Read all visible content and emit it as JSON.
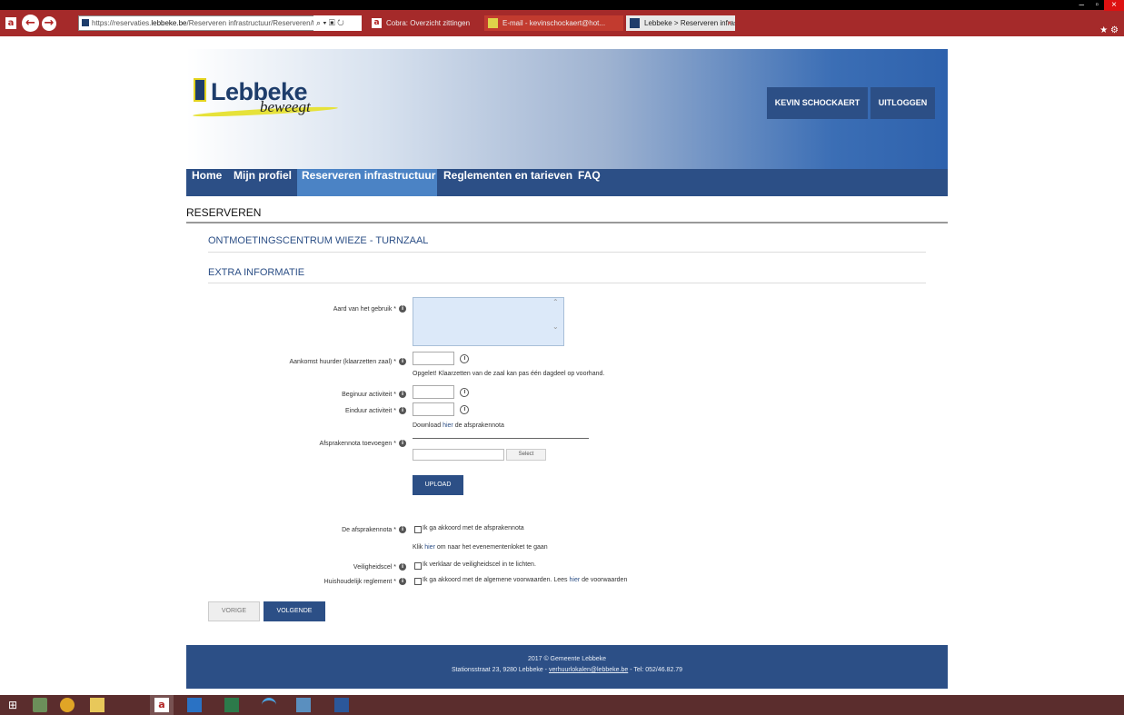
{
  "browser": {
    "address_prefix": "https://reservaties.",
    "address_domain": "lebbeke.be",
    "address_rest": "/Reserveren infrastructuur/Reserveren/tabid/96/ite",
    "address_icons": "⌕ ▾ ὑ2 ↻",
    "tabs": [
      {
        "label": "Cobra: Overzicht zittingen"
      },
      {
        "label": "E-mail - kevinschockaert@hot..."
      },
      {
        "label": "Lebbeke > Reserveren infras..."
      }
    ],
    "tab_close": "×",
    "back_glyph": "←",
    "forward_glyph": "→"
  },
  "header": {
    "logo_word": "Lebbeke",
    "logo_sub": "beweegt",
    "user_button": "KEVIN SCHOCKAERT",
    "logout_button": "UITLOGGEN"
  },
  "nav": {
    "home": "Home",
    "profiel": "Mijn profiel",
    "reserveren": "Reserveren infrastructuur",
    "reglementen": "Reglementen en tarieven",
    "faq": "FAQ"
  },
  "page": {
    "title": "RESERVEREN",
    "centrum": "ONTMOETINGSCENTRUM WIEZE - TURNZAAL",
    "extra": "EXTRA INFORMATIE"
  },
  "form": {
    "info_glyph": "i",
    "aard_label": "Aard van het gebruik *",
    "aankomst_label": "Aankomst huurder (klaarzetten zaal) *",
    "opgelet_note": "Opgelet! Klaarzetten van de zaal kan pas één dagdeel op voorhand.",
    "begin_label": "Beginuur activiteit *",
    "eind_label": "Einduur activiteit *",
    "download_pre": "Download",
    "download_link": "hier",
    "download_post": "de afsprakennota",
    "nota_label": "Afsprakennota toevoegen *",
    "select_button": "Select",
    "upload_button": "UPLOAD",
    "akkoord_label": "De afsprakennota *",
    "akkoord_text": "Ik ga akkoord met de afsprakennota",
    "klik_pre": "Klik",
    "klik_link": "hier",
    "klik_post": "om naar het evenementenloket te gaan",
    "veilig_label": "Veiligheidscel *",
    "veilig_text": "Ik verklaar de veiligheidscel in te lichten.",
    "huis_label": "Huishoudelijk reglement *",
    "huis_pre": "Ik ga akkoord met de algemene voorwaarden. Lees",
    "huis_link": "hier",
    "huis_post": "de voorwaarden",
    "vorige_button": "VORIGE",
    "volgende_button": "VOLGENDE"
  },
  "footer": {
    "copyright": "2017 © Gemeente Lebbeke",
    "address": "Stationsstraat 23, 9280 Lebbeke -",
    "email": "verhuurlokalen@lebbeke.be",
    "phone": "- Tel: 052/46.82.79"
  },
  "colors": {
    "brand_blue": "#2c4f86",
    "active_nav": "#4b83c5",
    "browser_frame": "#a52a2a",
    "taskbar": "#5b2d2d"
  }
}
